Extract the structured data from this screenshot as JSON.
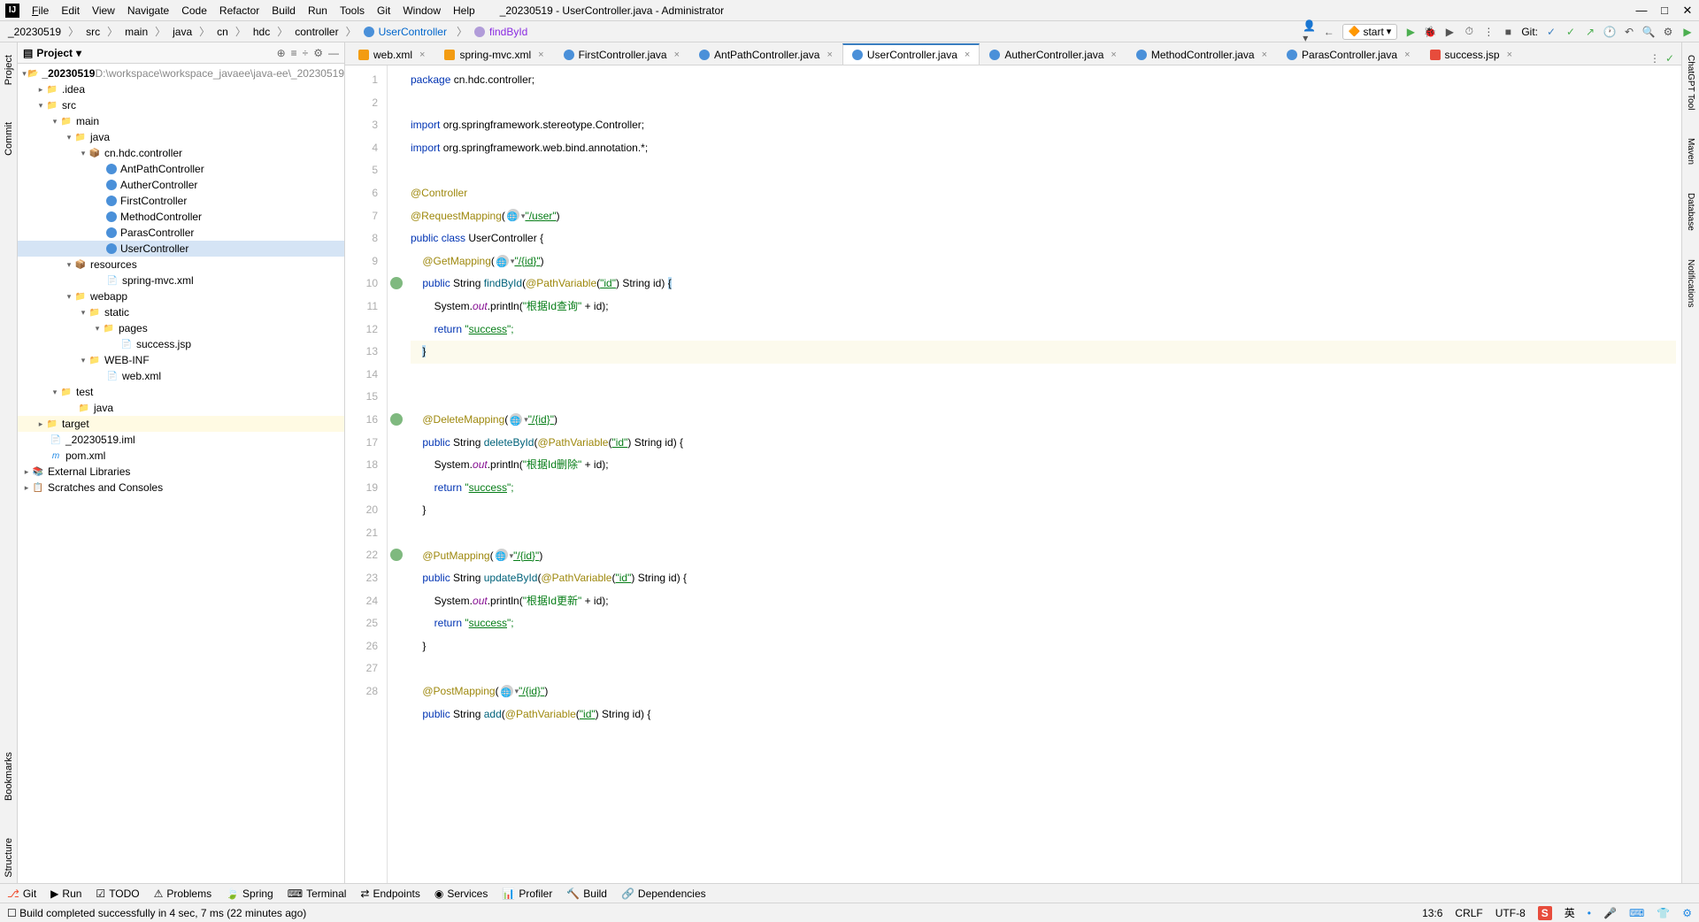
{
  "window": {
    "title": "_20230519 - UserController.java - Administrator"
  },
  "menus": [
    "File",
    "Edit",
    "View",
    "Navigate",
    "Code",
    "Refactor",
    "Build",
    "Run",
    "Tools",
    "Git",
    "Window",
    "Help"
  ],
  "breadcrumb": [
    "_20230519",
    "src",
    "main",
    "java",
    "cn",
    "hdc",
    "controller",
    "UserController",
    "findById"
  ],
  "run_config": "start",
  "git_label": "Git:",
  "left_tabs": [
    "Project",
    "Commit"
  ],
  "left_tabs_bottom": [
    "Bookmarks",
    "Structure"
  ],
  "right_tabs": [
    "ChatGPT Tool",
    "Maven",
    "Database",
    "Notifications"
  ],
  "project_label": "Project",
  "tree": {
    "root": "_20230519",
    "root_path": "D:\\workspace\\workspace_javaee\\java-ee\\_20230519",
    "items": [
      ".idea",
      "src",
      "main",
      "java",
      "cn.hdc.controller",
      "AntPathController",
      "AutherController",
      "FirstController",
      "MethodController",
      "ParasController",
      "UserController",
      "resources",
      "spring-mvc.xml",
      "webapp",
      "static",
      "pages",
      "success.jsp",
      "WEB-INF",
      "web.xml",
      "test",
      "java",
      "target",
      "_20230519.iml",
      "pom.xml",
      "External Libraries",
      "Scratches and Consoles"
    ]
  },
  "tabs": [
    "web.xml",
    "spring-mvc.xml",
    "FirstController.java",
    "AntPathController.java",
    "UserController.java",
    "AutherController.java",
    "MethodController.java",
    "ParasController.java",
    "success.jsp"
  ],
  "active_tab": "UserController.java",
  "code_lines": {
    "l1": "package cn.hdc.controller;",
    "l3a": "import",
    "l3b": "org.springframework.stereotype.",
    "l3c": "Controller",
    "l3d": ";",
    "l4a": "import",
    "l4b": "org.springframework.web.bind.annotation.*;",
    "l6": "@Controller",
    "l7a": "@RequestMapping",
    "l7b": "\"/user\"",
    "l8a": "public class",
    "l8b": "UserController {",
    "l9a": "@GetMapping",
    "l9b": "\"/{id}\"",
    "l10a": "public",
    "l10b": "String",
    "l10c": "findById",
    "l10d": "@PathVariable",
    "l10e": "\"id\"",
    "l10f": "String id)",
    "l10g": "{",
    "l11a": "System.",
    "l11b": "out",
    "l11c": ".println(",
    "l11d": "\"根据Id查询\"",
    "l11e": " + id);",
    "l12a": "return",
    "l12b": "\"",
    "l12c": "success",
    "l12d": "\";",
    "l13": "}",
    "l15a": "@DeleteMapping",
    "l15b": "\"/{id}\"",
    "l16a": "public",
    "l16b": "String",
    "l16c": "deleteById",
    "l16d": "@PathVariable",
    "l16e": "\"id\"",
    "l16f": "String id) {",
    "l17a": "System.",
    "l17b": "out",
    "l17c": ".println(",
    "l17d": "\"根据Id删除\"",
    "l17e": " + id);",
    "l18a": "return",
    "l18b": "\"",
    "l18c": "success",
    "l18d": "\";",
    "l19": "}",
    "l21a": "@PutMapping",
    "l21b": "\"/{id}\"",
    "l22a": "public",
    "l22b": "String",
    "l22c": "updateById",
    "l22d": "@PathVariable",
    "l22e": "\"id\"",
    "l22f": "String id) {",
    "l23a": "System.",
    "l23b": "out",
    "l23c": ".println(",
    "l23d": "\"根据Id更新\"",
    "l23e": " + id);",
    "l24a": "return",
    "l24b": "\"",
    "l24c": "success",
    "l24d": "\";",
    "l25": "}",
    "l27a": "@PostMapping",
    "l27b": "\"/{id}\"",
    "l28a": "public",
    "l28b": "String",
    "l28c": "add",
    "l28d": "@PathVariable",
    "l28e": "\"id\"",
    "l28f": "String id) {"
  },
  "bottom_tools": [
    "Git",
    "Run",
    "TODO",
    "Problems",
    "Spring",
    "Terminal",
    "Endpoints",
    "Services",
    "Profiler",
    "Build",
    "Dependencies"
  ],
  "status": {
    "msg": "Build completed successfully in 4 sec, 7 ms (22 minutes ago)",
    "pos": "13:6",
    "le": "CRLF",
    "enc": "UTF-8",
    "ime": "英"
  }
}
